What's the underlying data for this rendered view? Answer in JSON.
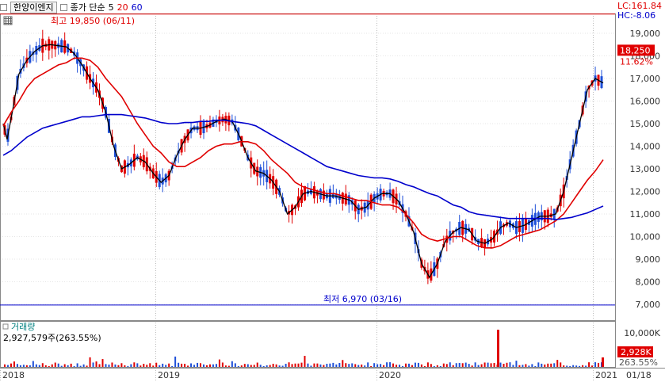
{
  "header": {
    "stock_name": "한양이엔지",
    "ma_label": "종가 단순",
    "ma_periods": [
      "5",
      "20",
      "60"
    ],
    "ma_colors": [
      "#000000",
      "#e00000",
      "#0000cc"
    ]
  },
  "right_labels": {
    "lc": "LC:161.84",
    "hc": "HC:-8.06",
    "last_price": "18,250",
    "last_change": "11.62%",
    "last_volume": "2,928K",
    "last_volume_pct": "263.55%",
    "date_label": "01/18"
  },
  "annotations": {
    "high": "최고 19,850 (06/11)",
    "low": "최저 6,970 (03/16)"
  },
  "volume_panel": {
    "title": "거래량",
    "value": "2,927,579주(263.55%)"
  },
  "chart_data": {
    "type": "candlestick",
    "price_axis": {
      "ticks": [
        7000,
        8000,
        9000,
        10000,
        11000,
        12000,
        13000,
        14000,
        15000,
        16000,
        17000,
        18000,
        19000
      ]
    },
    "volume_axis": {
      "ticks": [
        "10,000K"
      ]
    },
    "x_ticks": [
      "2018",
      "2019",
      "2020",
      "2021"
    ],
    "high_line": 19850,
    "low_line": 6970,
    "last_close": 18250,
    "ma5": [
      [
        0,
        15000
      ],
      [
        5,
        14300
      ],
      [
        12,
        15600
      ],
      [
        20,
        17200
      ],
      [
        30,
        17800
      ],
      [
        40,
        18200
      ],
      [
        50,
        18450
      ],
      [
        60,
        18500
      ],
      [
        70,
        18450
      ],
      [
        80,
        18400
      ],
      [
        90,
        18100
      ],
      [
        100,
        17600
      ],
      [
        110,
        17000
      ],
      [
        120,
        16500
      ],
      [
        130,
        15500
      ],
      [
        140,
        14000
      ],
      [
        150,
        13000
      ],
      [
        160,
        13200
      ],
      [
        170,
        13500
      ],
      [
        180,
        13300
      ],
      [
        190,
        12800
      ],
      [
        200,
        12400
      ],
      [
        210,
        12700
      ],
      [
        220,
        13600
      ],
      [
        230,
        14300
      ],
      [
        240,
        14800
      ],
      [
        250,
        14800
      ],
      [
        260,
        14900
      ],
      [
        270,
        15100
      ],
      [
        280,
        15200
      ],
      [
        290,
        15100
      ],
      [
        300,
        14400
      ],
      [
        310,
        13500
      ],
      [
        320,
        12900
      ],
      [
        330,
        12800
      ],
      [
        340,
        12500
      ],
      [
        350,
        12000
      ],
      [
        360,
        11000
      ],
      [
        370,
        11300
      ],
      [
        380,
        11900
      ],
      [
        390,
        12000
      ],
      [
        400,
        11900
      ],
      [
        410,
        11800
      ],
      [
        420,
        11800
      ],
      [
        430,
        11700
      ],
      [
        440,
        11600
      ],
      [
        450,
        11200
      ],
      [
        460,
        11300
      ],
      [
        470,
        11700
      ],
      [
        480,
        11900
      ],
      [
        490,
        11900
      ],
      [
        500,
        11600
      ],
      [
        510,
        11000
      ],
      [
        520,
        10200
      ],
      [
        530,
        8800
      ],
      [
        540,
        8200
      ],
      [
        550,
        8800
      ],
      [
        560,
        9800
      ],
      [
        570,
        10200
      ],
      [
        580,
        10400
      ],
      [
        590,
        10300
      ],
      [
        600,
        9800
      ],
      [
        610,
        9700
      ],
      [
        620,
        9900
      ],
      [
        630,
        10400
      ],
      [
        640,
        10600
      ],
      [
        650,
        10400
      ],
      [
        660,
        10500
      ],
      [
        670,
        10700
      ],
      [
        680,
        10900
      ],
      [
        690,
        10900
      ],
      [
        700,
        11000
      ],
      [
        710,
        12000
      ],
      [
        720,
        13500
      ],
      [
        730,
        15000
      ],
      [
        740,
        16500
      ],
      [
        750,
        17000
      ],
      [
        760,
        16800
      ]
    ],
    "ma20": [
      [
        0,
        14900
      ],
      [
        10,
        15500
      ],
      [
        20,
        16000
      ],
      [
        30,
        16600
      ],
      [
        40,
        17000
      ],
      [
        50,
        17200
      ],
      [
        60,
        17400
      ],
      [
        70,
        17600
      ],
      [
        80,
        17700
      ],
      [
        90,
        17900
      ],
      [
        100,
        17900
      ],
      [
        110,
        17800
      ],
      [
        120,
        17500
      ],
      [
        130,
        17000
      ],
      [
        140,
        16600
      ],
      [
        150,
        16200
      ],
      [
        160,
        15600
      ],
      [
        170,
        15000
      ],
      [
        180,
        14500
      ],
      [
        190,
        14000
      ],
      [
        200,
        13700
      ],
      [
        210,
        13300
      ],
      [
        220,
        13100
      ],
      [
        230,
        13100
      ],
      [
        240,
        13300
      ],
      [
        250,
        13500
      ],
      [
        260,
        13800
      ],
      [
        270,
        14000
      ],
      [
        280,
        14100
      ],
      [
        290,
        14100
      ],
      [
        300,
        14200
      ],
      [
        310,
        14200
      ],
      [
        320,
        14100
      ],
      [
        330,
        13800
      ],
      [
        340,
        13400
      ],
      [
        350,
        13100
      ],
      [
        360,
        12800
      ],
      [
        370,
        12400
      ],
      [
        380,
        12200
      ],
      [
        390,
        12100
      ],
      [
        400,
        12000
      ],
      [
        410,
        11900
      ],
      [
        420,
        11900
      ],
      [
        430,
        11800
      ],
      [
        440,
        11700
      ],
      [
        450,
        11600
      ],
      [
        460,
        11600
      ],
      [
        470,
        11500
      ],
      [
        480,
        11400
      ],
      [
        490,
        11400
      ],
      [
        500,
        11300
      ],
      [
        510,
        11000
      ],
      [
        520,
        10600
      ],
      [
        530,
        10100
      ],
      [
        540,
        9900
      ],
      [
        550,
        9800
      ],
      [
        560,
        9900
      ],
      [
        570,
        10000
      ],
      [
        580,
        10000
      ],
      [
        590,
        9800
      ],
      [
        600,
        9600
      ],
      [
        610,
        9500
      ],
      [
        620,
        9500
      ],
      [
        630,
        9600
      ],
      [
        640,
        9800
      ],
      [
        650,
        10000
      ],
      [
        660,
        10100
      ],
      [
        670,
        10200
      ],
      [
        680,
        10300
      ],
      [
        690,
        10500
      ],
      [
        700,
        10700
      ],
      [
        710,
        11000
      ],
      [
        720,
        11500
      ],
      [
        730,
        12000
      ],
      [
        740,
        12500
      ],
      [
        750,
        12900
      ],
      [
        760,
        13400
      ]
    ],
    "ma60": [
      [
        0,
        13600
      ],
      [
        10,
        13800
      ],
      [
        20,
        14100
      ],
      [
        30,
        14400
      ],
      [
        40,
        14600
      ],
      [
        50,
        14800
      ],
      [
        60,
        14900
      ],
      [
        70,
        15000
      ],
      [
        80,
        15100
      ],
      [
        90,
        15200
      ],
      [
        100,
        15300
      ],
      [
        110,
        15300
      ],
      [
        120,
        15350
      ],
      [
        130,
        15400
      ],
      [
        140,
        15400
      ],
      [
        150,
        15400
      ],
      [
        160,
        15350
      ],
      [
        170,
        15300
      ],
      [
        180,
        15250
      ],
      [
        190,
        15150
      ],
      [
        200,
        15050
      ],
      [
        210,
        15000
      ],
      [
        220,
        15000
      ],
      [
        230,
        15050
      ],
      [
        240,
        15050
      ],
      [
        250,
        15100
      ],
      [
        260,
        15100
      ],
      [
        270,
        15150
      ],
      [
        280,
        15150
      ],
      [
        290,
        15100
      ],
      [
        300,
        15050
      ],
      [
        310,
        15000
      ],
      [
        320,
        14900
      ],
      [
        330,
        14700
      ],
      [
        340,
        14500
      ],
      [
        350,
        14300
      ],
      [
        360,
        14100
      ],
      [
        370,
        13900
      ],
      [
        380,
        13700
      ],
      [
        390,
        13500
      ],
      [
        400,
        13300
      ],
      [
        410,
        13100
      ],
      [
        420,
        13000
      ],
      [
        430,
        12900
      ],
      [
        440,
        12800
      ],
      [
        450,
        12700
      ],
      [
        460,
        12650
      ],
      [
        470,
        12600
      ],
      [
        480,
        12600
      ],
      [
        490,
        12550
      ],
      [
        500,
        12450
      ],
      [
        510,
        12300
      ],
      [
        520,
        12200
      ],
      [
        530,
        12050
      ],
      [
        540,
        11900
      ],
      [
        550,
        11800
      ],
      [
        560,
        11600
      ],
      [
        570,
        11400
      ],
      [
        580,
        11300
      ],
      [
        590,
        11100
      ],
      [
        600,
        11000
      ],
      [
        610,
        10950
      ],
      [
        620,
        10900
      ],
      [
        630,
        10850
      ],
      [
        640,
        10800
      ],
      [
        650,
        10800
      ],
      [
        660,
        10800
      ],
      [
        670,
        10800
      ],
      [
        680,
        10800
      ],
      [
        690,
        10800
      ],
      [
        700,
        10750
      ],
      [
        710,
        10800
      ],
      [
        720,
        10850
      ],
      [
        730,
        10950
      ],
      [
        740,
        11050
      ],
      [
        750,
        11200
      ],
      [
        760,
        11350
      ]
    ]
  }
}
